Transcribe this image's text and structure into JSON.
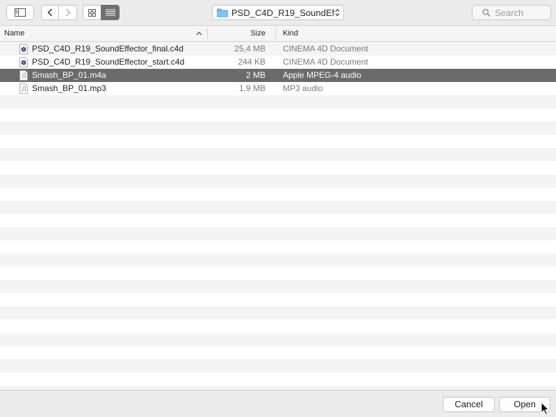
{
  "toolbar": {
    "sidebar_icon": "sidebar-toggle-icon",
    "back_icon": "chevron-left-icon",
    "forward_icon": "chevron-right-icon",
    "icon_view_icon": "icon-grid-icon",
    "list_view_icon": "list-view-icon",
    "location": "PSD_C4D_R19_SoundEf…",
    "search_placeholder": "Search"
  },
  "columns": {
    "name": "Name",
    "size": "Size",
    "kind": "Kind"
  },
  "files": [
    {
      "name": "PSD_C4D_R19_SoundEffector_final.c4d",
      "size": "25,4 MB",
      "kind": "CINEMA 4D Document",
      "icon": "c4d-document-icon",
      "selected": false
    },
    {
      "name": "PSD_C4D_R19_SoundEffector_start.c4d",
      "size": "244 KB",
      "kind": "CINEMA 4D Document",
      "icon": "c4d-document-icon",
      "selected": false
    },
    {
      "name": "Smash_BP_01.m4a",
      "size": "2 MB",
      "kind": "Apple MPEG-4 audio",
      "icon": "audio-file-icon",
      "selected": true
    },
    {
      "name": "Smash_BP_01.mp3",
      "size": "1,9 MB",
      "kind": "MP3 audio",
      "icon": "audio-file-icon",
      "selected": false
    }
  ],
  "buttons": {
    "cancel": "Cancel",
    "open": "Open"
  },
  "colors": {
    "selection": "#6b6b6b",
    "stripe": "#f4f4f4",
    "folder": "#61b3ea"
  }
}
